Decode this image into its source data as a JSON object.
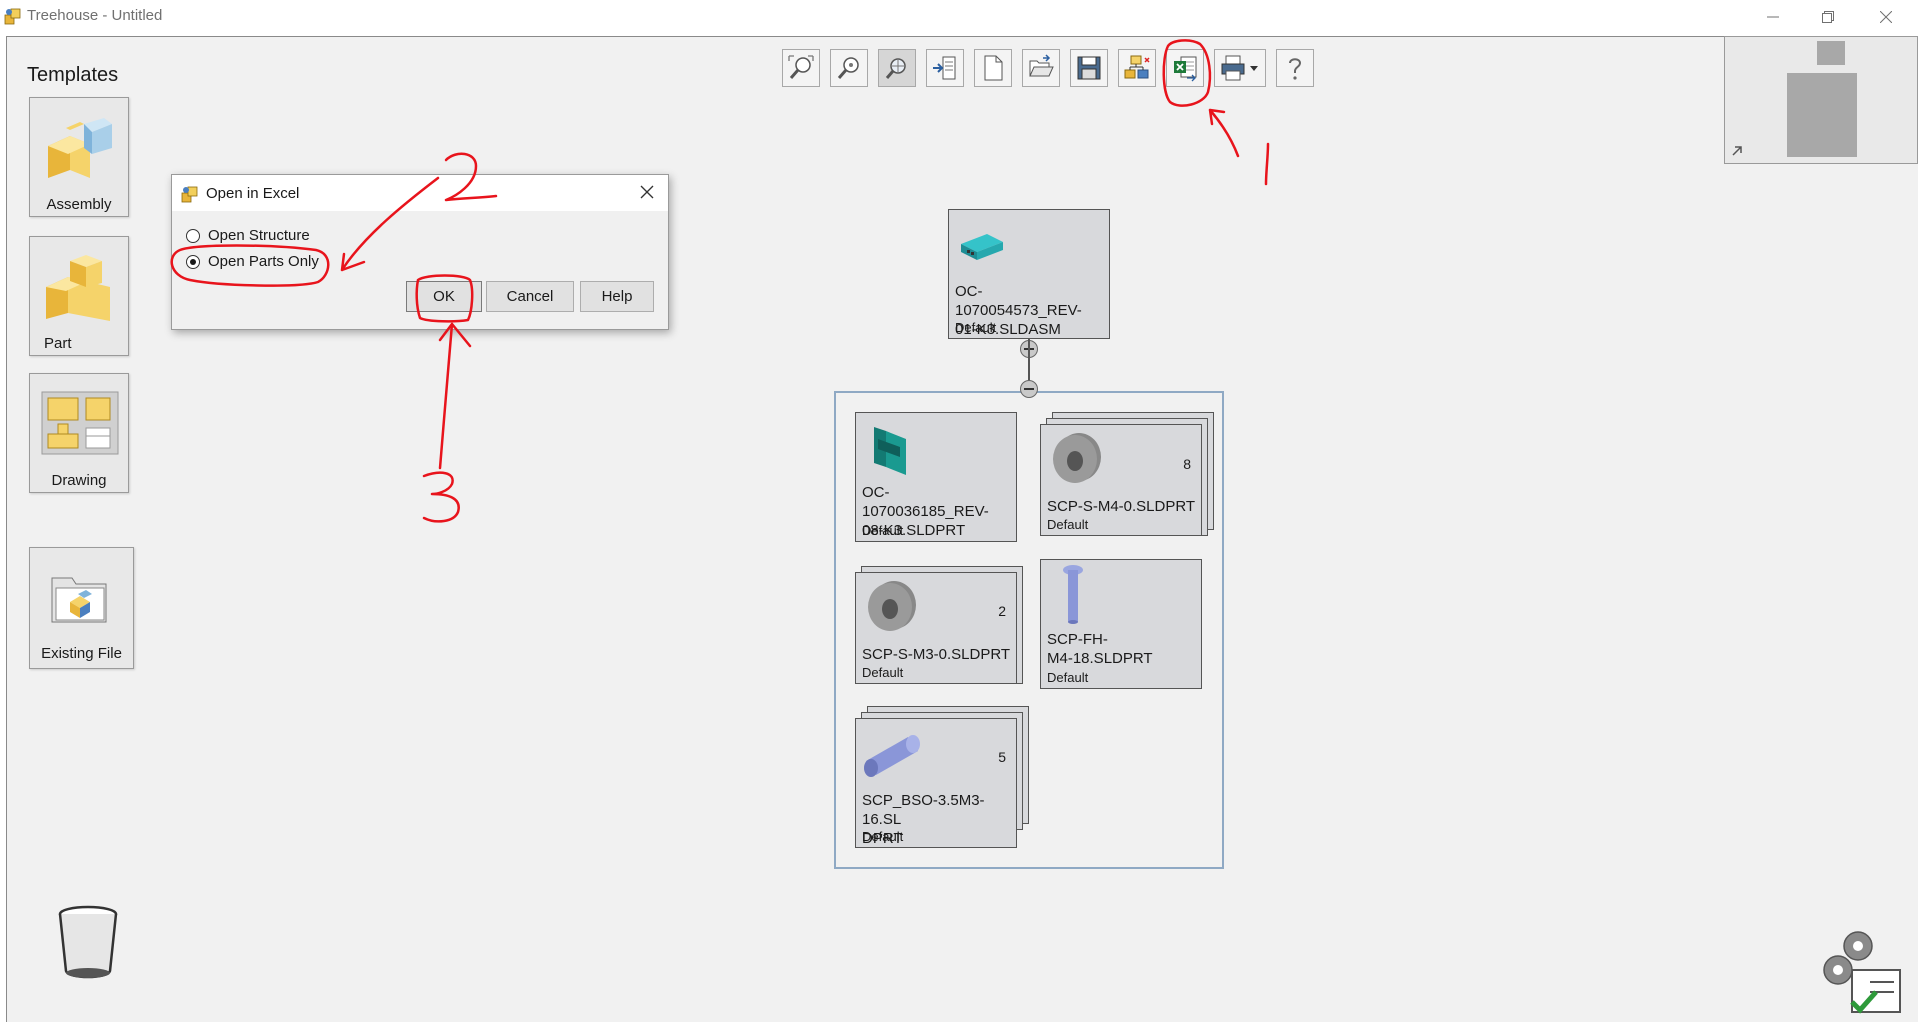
{
  "window": {
    "title": "Treehouse - Untitled",
    "controls": [
      "minimize",
      "restore",
      "close"
    ]
  },
  "templates": {
    "title": "Templates",
    "items": [
      {
        "label": "Assembly",
        "icon": "assembly-icon"
      },
      {
        "label": "Part",
        "icon": "part-icon"
      },
      {
        "label": "Drawing",
        "icon": "drawing-icon"
      },
      {
        "label": "Existing File",
        "icon": "existing-file-icon"
      }
    ]
  },
  "toolbar": {
    "buttons": [
      "zoom-to-fit-icon",
      "zoom-icon",
      "zoom-selection-icon",
      "insert-icon",
      "new-document-icon",
      "open-icon",
      "save-icon",
      "structure-icon",
      "open-in-excel-icon",
      "print-icon",
      "help-icon"
    ]
  },
  "dialog": {
    "title": "Open in Excel",
    "options": [
      {
        "label": "Open Structure",
        "checked": false
      },
      {
        "label": "Open Parts Only",
        "checked": true
      }
    ],
    "ok": "OK",
    "cancel": "Cancel",
    "help": "Help"
  },
  "tree": {
    "root": {
      "name": "OC-1070054573_REV-01-K3.SLDASM",
      "name_lines": [
        "OC-1070054573_REV-",
        "01-K3.SLDASM"
      ],
      "config": "Default"
    },
    "children": [
      {
        "name_lines": [
          "OC-1070036185_REV-",
          "08-K3.SLDPRT"
        ],
        "config": "Default",
        "qty": ""
      },
      {
        "name_lines": [
          "SCP-S-M4-0.SLDPRT"
        ],
        "config": "Default",
        "qty": "8"
      },
      {
        "name_lines": [
          "SCP-S-M3-0.SLDPRT"
        ],
        "config": "Default",
        "qty": "2"
      },
      {
        "name_lines": [
          "SCP-FH-",
          "M4-18.SLDPRT"
        ],
        "config": "Default",
        "qty": ""
      },
      {
        "name_lines": [
          "SCP_BSO-3.5M3-16.SL",
          "DPRT"
        ],
        "config": "Default",
        "qty": "5"
      }
    ]
  },
  "annotations": {
    "step1": "1",
    "step2": "2",
    "step3": "3"
  },
  "colors": {
    "annotation": "#e8141c",
    "canvas": "#f1f1f1",
    "node": "#d8d9dc",
    "group_border": "#8fa9c4"
  }
}
